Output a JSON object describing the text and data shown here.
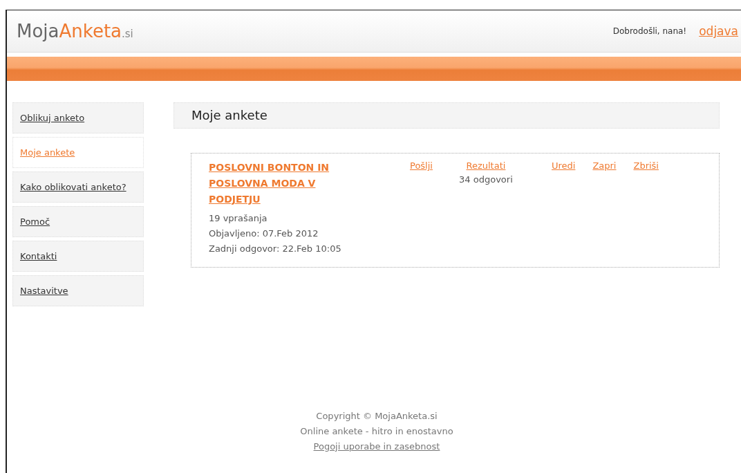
{
  "header": {
    "logo": [
      {
        "text": "Moja",
        "kind": "plain"
      },
      {
        "text": "Anketa",
        "kind": "accent"
      },
      {
        "text": ".si",
        "kind": "suffix"
      }
    ],
    "greeting": "Dobrodošli, nana!",
    "logout": "odjava"
  },
  "sidebar": {
    "items": [
      {
        "label": "Oblikuj anketo",
        "selected": false
      },
      {
        "label": "Moje ankete",
        "selected": true
      },
      {
        "label": "Kako oblikovati anketo?",
        "selected": false
      },
      {
        "label": "Pomoč",
        "selected": false
      },
      {
        "label": "Kontakti",
        "selected": false
      },
      {
        "label": "Nastavitve",
        "selected": false
      }
    ]
  },
  "page_title": "Moje ankete",
  "surveys": [
    {
      "title": "POSLOVNI BONTON IN POSLOVNA MODA V PODJETJU",
      "details": [
        "19 vprašanja",
        "Objavljeno: 07.Feb 2012",
        "Zadnji odgovor: 22.Feb 10:05"
      ],
      "send": "Pošlji",
      "results": "Rezultati",
      "responses": "34 odgovori",
      "actions": [
        "Uredi",
        "Zapri",
        "Zbriši"
      ]
    }
  ],
  "footer": {
    "copyright": "Copyright © MojaAnketa.si",
    "tagline": "Online ankete - hitro in enostavno",
    "terms_link": "Pogoji uporabe in zasebnost"
  }
}
